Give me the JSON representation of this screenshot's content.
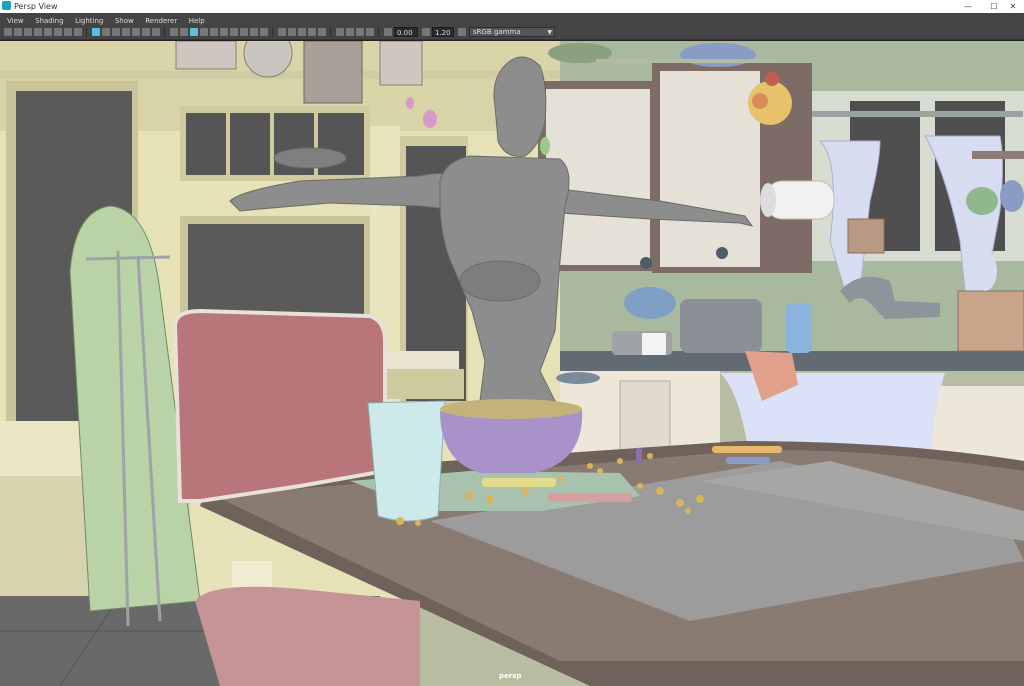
{
  "window": {
    "title": "Persp View",
    "min_glyph": "—",
    "max_glyph": "☐",
    "close_glyph": "✕"
  },
  "menu": {
    "items": [
      "View",
      "Shading",
      "Lighting",
      "Show",
      "Renderer",
      "Help"
    ]
  },
  "toolbar": {
    "exposure_value": "0.00",
    "gamma_value": "1.20",
    "color_space": "sRGB gamma"
  },
  "viewport": {
    "camera_label": "persp"
  }
}
